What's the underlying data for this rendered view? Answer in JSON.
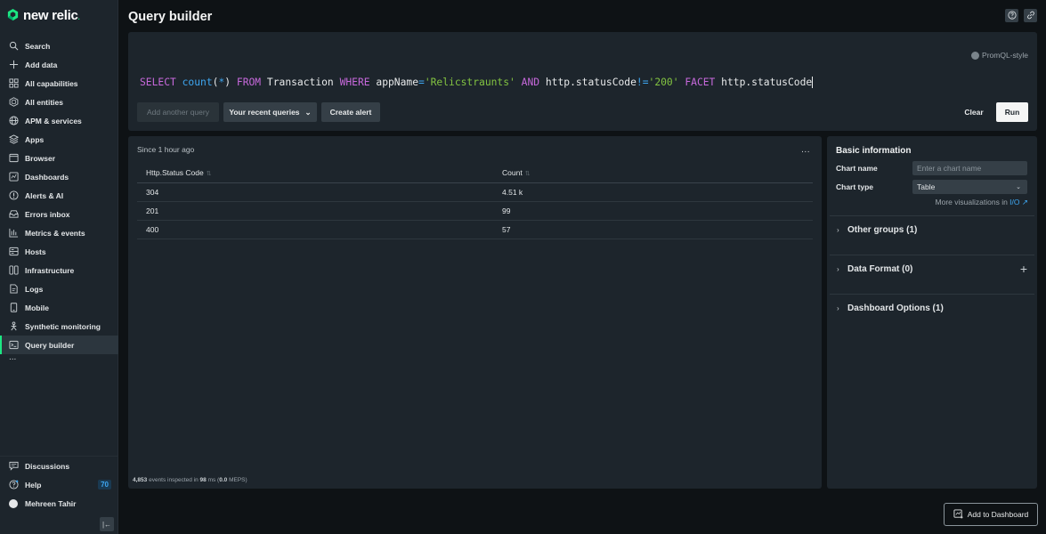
{
  "app": {
    "logo_text": "new relic",
    "brand_color": "#1ce783"
  },
  "sidebar": {
    "items": [
      {
        "label": "Search",
        "icon": "search-icon"
      },
      {
        "label": "Add data",
        "icon": "plus-icon"
      },
      {
        "label": "All capabilities",
        "icon": "grid-icon"
      },
      {
        "label": "All entities",
        "icon": "hexagon-icon"
      },
      {
        "label": "APM & services",
        "icon": "globe-icon"
      },
      {
        "label": "Apps",
        "icon": "layers-icon"
      },
      {
        "label": "Browser",
        "icon": "browser-icon"
      },
      {
        "label": "Dashboards",
        "icon": "dashboard-icon"
      },
      {
        "label": "Alerts & AI",
        "icon": "alert-icon"
      },
      {
        "label": "Errors inbox",
        "icon": "inbox-icon"
      },
      {
        "label": "Metrics & events",
        "icon": "bar-chart-icon"
      },
      {
        "label": "Hosts",
        "icon": "server-icon"
      },
      {
        "label": "Infrastructure",
        "icon": "infrastructure-icon"
      },
      {
        "label": "Logs",
        "icon": "document-icon"
      },
      {
        "label": "Mobile",
        "icon": "mobile-icon"
      },
      {
        "label": "Synthetic monitoring",
        "icon": "synthetic-icon"
      },
      {
        "label": "Query builder",
        "icon": "terminal-icon",
        "active": true
      }
    ],
    "more": "...",
    "bottom": {
      "discussions": "Discussions",
      "help": "Help",
      "help_badge": "70",
      "user": "Mehreen Tahir"
    }
  },
  "header": {
    "title": "Query builder"
  },
  "query": {
    "promql_label": "PromQL-style",
    "tokens": {
      "select": "SELECT",
      "count": "count",
      "open": "(",
      "star": "*",
      "close": ")",
      "from": "FROM",
      "table": "Transaction",
      "where": "WHERE",
      "attr1": "appName",
      "eq": "=",
      "val1": "'Relicstraunts'",
      "and": "AND",
      "attr2": "http.statusCode",
      "neq": "!=",
      "val2": "'200'",
      "facet": "FACET",
      "attr3": "http.statusCode"
    },
    "buttons": {
      "add_query": "Add another query",
      "recent": "Your recent queries",
      "create_alert": "Create alert",
      "clear": "Clear",
      "run": "Run"
    }
  },
  "results": {
    "since": "Since 1 hour ago",
    "more": "...",
    "columns": [
      "Http.Status Code",
      "Count"
    ],
    "rows": [
      [
        "304",
        "4.51 k"
      ],
      [
        "201",
        "99"
      ],
      [
        "400",
        "57"
      ]
    ],
    "footer": {
      "events": "4,853",
      "text1": " events inspected in ",
      "ms": "98",
      "text2": " ms (",
      "meps": "0.0",
      "text3": " MEPS)"
    }
  },
  "settings": {
    "title": "Basic information",
    "chart_name_label": "Chart name",
    "chart_name_placeholder": "Enter a chart name",
    "chart_type_label": "Chart type",
    "chart_type_value": "Table",
    "more_vis_text": "More visualizations in ",
    "more_vis_link": "I/O",
    "sections": [
      {
        "label": "Other groups (1)"
      },
      {
        "label": "Data Format (0)"
      },
      {
        "label": "Dashboard Options (1)"
      }
    ]
  },
  "actions": {
    "add_to_dashboard": "Add to Dashboard"
  }
}
